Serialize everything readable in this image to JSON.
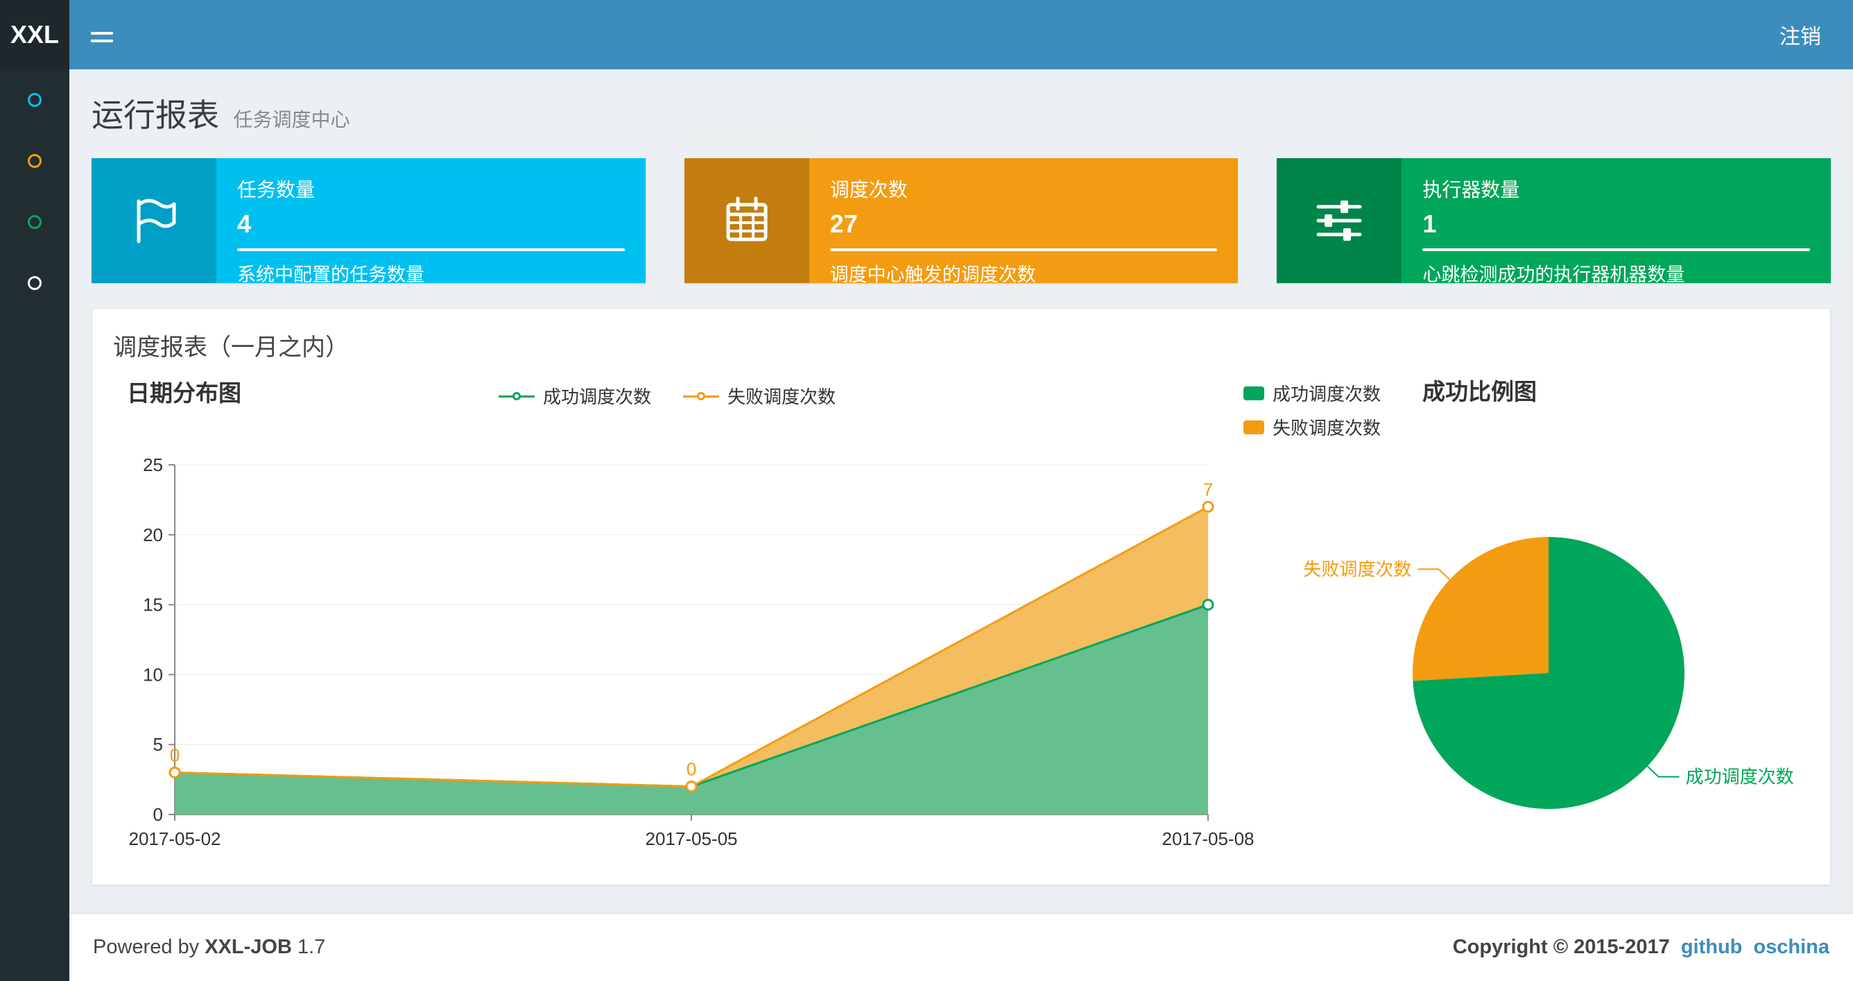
{
  "navbar": {
    "logo": "XXL",
    "logout": "注销"
  },
  "sidebar": {
    "items": [
      {
        "color": "#00c0ef"
      },
      {
        "color": "#f39c12"
      },
      {
        "color": "#00a65a"
      },
      {
        "color": "#ffffff"
      }
    ]
  },
  "page": {
    "title": "运行报表",
    "subtitle": "任务调度中心"
  },
  "info_boxes": [
    {
      "label": "任务数量",
      "value": "4",
      "description": "系统中配置的任务数量",
      "bg": "#00c0ef",
      "icon_bg": "#009fc6",
      "icon": "flag-icon"
    },
    {
      "label": "调度次数",
      "value": "27",
      "description": "调度中心触发的调度次数",
      "bg": "#f39c12",
      "icon_bg": "#c27d0e",
      "icon": "calendar-icon"
    },
    {
      "label": "执行器数量",
      "value": "1",
      "description": "心跳检测成功的执行器机器数量",
      "bg": "#00a65a",
      "icon_bg": "#008548",
      "icon": "sliders-icon"
    }
  ],
  "panel": {
    "title": "调度报表（一月之内）"
  },
  "chart_data": [
    {
      "type": "area",
      "title": "日期分布图",
      "stacked": true,
      "categories": [
        "2017-05-02",
        "2017-05-05",
        "2017-05-08"
      ],
      "series": [
        {
          "name": "成功调度次数",
          "values": [
            3,
            2,
            15
          ],
          "color": "#00a65a",
          "fill": "#66bf8e"
        },
        {
          "name": "失败调度次数",
          "values": [
            0,
            0,
            7
          ],
          "color": "#f39c12",
          "fill": "#f3bd60",
          "point_labels": [
            "0",
            "0",
            "7"
          ]
        }
      ],
      "ylim": [
        0,
        25
      ],
      "y_ticks": [
        0,
        5,
        10,
        15,
        20,
        25
      ],
      "grid": true,
      "legend_position": "top-center"
    },
    {
      "type": "pie",
      "title": "成功比例图",
      "slices": [
        {
          "name": "成功调度次数",
          "value": 20,
          "color": "#00a65a"
        },
        {
          "name": "失败调度次数",
          "value": 7,
          "color": "#f39c12"
        }
      ],
      "legend_position": "top-left",
      "label_position": "outside"
    }
  ],
  "footer": {
    "powered_prefix": "Powered by",
    "app_name": "XXL-JOB",
    "version": "1.7",
    "copyright": "Copyright © 2015-2017",
    "links": [
      "github",
      "oschina"
    ],
    "link_color": "#3c8dbc"
  }
}
